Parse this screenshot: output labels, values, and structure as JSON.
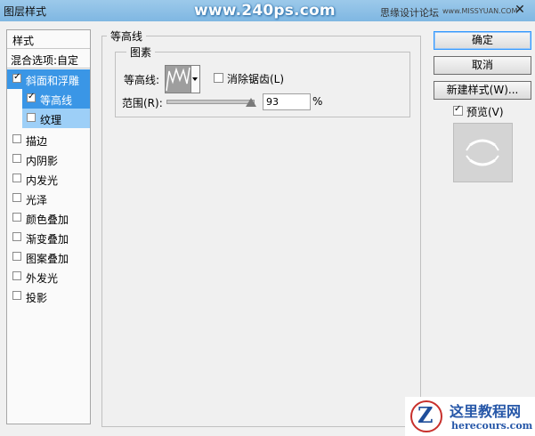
{
  "window": {
    "title": "图层样式",
    "watermark_site": "www.240ps.com",
    "watermark_forum": "思缘设计论坛",
    "watermark_url": "www.MISSYUAN.COM",
    "close_glyph": "✕"
  },
  "style_list": {
    "header": "样式",
    "blend_options": "混合选项:自定",
    "items": [
      {
        "label": "斜面和浮雕",
        "checked": true,
        "selected": "strong"
      },
      {
        "label": "等高线",
        "checked": true,
        "selected": "strong",
        "indent": true
      },
      {
        "label": "纹理",
        "checked": false,
        "selected": "light",
        "indent": true
      },
      {
        "label": "描边",
        "checked": false
      },
      {
        "label": "内阴影",
        "checked": false
      },
      {
        "label": "内发光",
        "checked": false
      },
      {
        "label": "光泽",
        "checked": false
      },
      {
        "label": "颜色叠加",
        "checked": false
      },
      {
        "label": "渐变叠加",
        "checked": false
      },
      {
        "label": "图案叠加",
        "checked": false
      },
      {
        "label": "外发光",
        "checked": false
      },
      {
        "label": "投影",
        "checked": false
      }
    ]
  },
  "contour_panel": {
    "group_title": "等高线",
    "subgroup_title": "图素",
    "contour_label": "等高线:",
    "antialias_label": "消除锯齿(L)",
    "antialias_checked": false,
    "range_label": "范围(R):",
    "range_value": "93",
    "range_unit": "%",
    "range_fraction": 0.93
  },
  "buttons": {
    "ok": "确定",
    "cancel": "取消",
    "new_style": "新建样式(W)...",
    "preview_label": "预览(V)",
    "preview_checked": true
  },
  "corner_logo": {
    "glyph": "Z",
    "name": "这里教程网",
    "url": "herecours.com"
  },
  "colors": {
    "selection_strong": "#3a96e6",
    "selection_light": "#9dcff7",
    "titlebar": "#8ec0e6"
  }
}
